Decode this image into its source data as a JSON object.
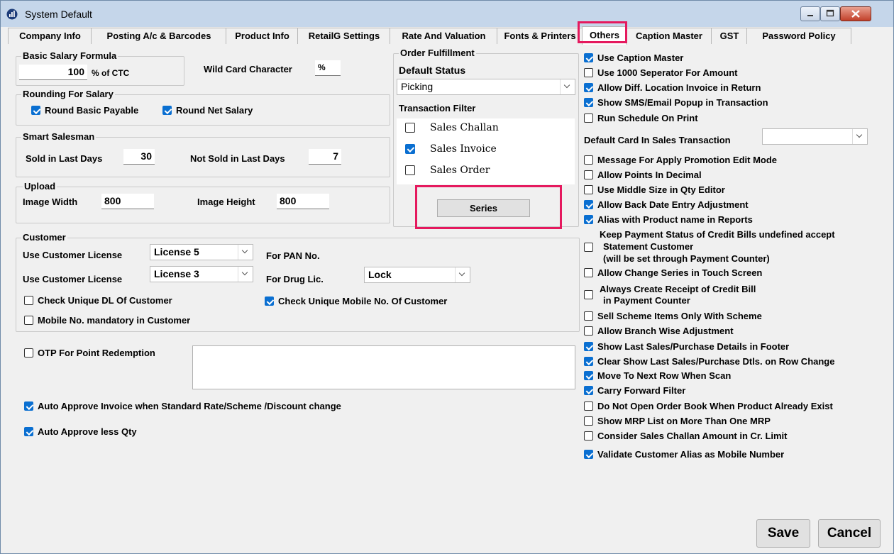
{
  "window": {
    "title": "System Default"
  },
  "tabs": [
    {
      "label": "Company Info"
    },
    {
      "label": "Posting A/c & Barcodes"
    },
    {
      "label": "Product Info"
    },
    {
      "label": "RetailG Settings"
    },
    {
      "label": "Rate And Valuation"
    },
    {
      "label": "Fonts & Printers"
    },
    {
      "label": "Others"
    },
    {
      "label": "Caption Master"
    },
    {
      "label": "GST"
    },
    {
      "label": "Password Policy"
    }
  ],
  "salary": {
    "title": "Basic Salary Formula",
    "value": "100",
    "unit": "% of CTC",
    "wildcard_label": "Wild Card Character",
    "wildcard_value": "%"
  },
  "rounding": {
    "title": "Rounding For Salary",
    "basic": "Round Basic Payable",
    "net": "Round Net Salary"
  },
  "smart": {
    "title": "Smart Salesman",
    "sold_label": "Sold in Last Days",
    "sold_value": "30",
    "notsold_label": "Not Sold in Last Days",
    "notsold_value": "7"
  },
  "upload": {
    "title": "Upload",
    "width_label": "Image Width",
    "width_value": "800",
    "height_label": "Image Height",
    "height_value": "800"
  },
  "order": {
    "title": "Order Fulfillment",
    "status_label": "Default Status",
    "status_value": "Picking",
    "filter_label": "Transaction Filter",
    "items": [
      {
        "label": "Sales Challan",
        "checked": false
      },
      {
        "label": "Sales Invoice",
        "checked": true
      },
      {
        "label": "Sales Order",
        "checked": false
      }
    ],
    "series_button": "Series"
  },
  "customer": {
    "title": "Customer",
    "license_label": "Use Customer License",
    "license1": "License 5",
    "pan_label": "For PAN No.",
    "license2": "License 3",
    "drug_label": "For Drug Lic.",
    "drug_value": "Lock",
    "unique_dl": "Check Unique DL Of Customer",
    "unique_mobile": "Check Unique Mobile No. Of Customer",
    "mobile_mandatory": "Mobile No. mandatory in Customer"
  },
  "otp_label": "OTP For Point Redemption",
  "auto_approve_invoice": "Auto Approve Invoice when Standard Rate/Scheme /Discount change",
  "auto_approve_qty": "Auto Approve less Qty",
  "right_options_a": [
    {
      "label": "Use Caption Master",
      "checked": true
    },
    {
      "label": "Use 1000 Seperator For Amount",
      "checked": false
    },
    {
      "label": "Allow Diff. Location Invoice in Return",
      "checked": true
    },
    {
      "label": "Show SMS/Email Popup in Transaction",
      "checked": true
    },
    {
      "label": "Run Schedule On Print",
      "checked": false
    }
  ],
  "default_card_label": "Default Card In Sales Transaction",
  "right_options_b": [
    {
      "label": "Message For Apply Promotion Edit Mode",
      "checked": false
    },
    {
      "label": "Allow Points In Decimal",
      "checked": false
    },
    {
      "label": "Use Middle Size in Qty Editor",
      "checked": false
    },
    {
      "label": "Allow Back Date Entry Adjustment",
      "checked": true
    },
    {
      "label": "Alias with Product name in Reports",
      "checked": true
    }
  ],
  "keep_payment": {
    "line1": "Keep Payment Status of Credit Bills undefined accept",
    "line2": "Statement Customer",
    "line3": "(will be set through Payment Counter)",
    "checked": false
  },
  "allow_change_series": {
    "label": "Allow Change Series in Touch Screen",
    "checked": false
  },
  "always_create": {
    "line1": "Always Create Receipt of Credit Bill",
    "line2": "in Payment Counter",
    "checked": false
  },
  "right_options_c": [
    {
      "label": "Sell Scheme Items Only With Scheme",
      "checked": false
    },
    {
      "label": "Allow Branch Wise Adjustment",
      "checked": false
    },
    {
      "label": "Show Last Sales/Purchase Details in Footer",
      "checked": true
    },
    {
      "label": "Clear Show Last Sales/Purchase Dtls. on Row Change",
      "checked": true
    },
    {
      "label": "Move To Next Row When Scan",
      "checked": true
    },
    {
      "label": "Carry Forward Filter",
      "checked": true
    },
    {
      "label": "Do Not Open Order Book When Product Already Exist",
      "checked": false
    },
    {
      "label": "Show MRP List on More Than One MRP",
      "checked": false
    },
    {
      "label": "Consider Sales Challan Amount in Cr. Limit",
      "checked": false
    }
  ],
  "validate_alias": {
    "label": "Validate Customer Alias as Mobile Number",
    "checked": true
  },
  "buttons": {
    "save": "Save",
    "cancel": "Cancel"
  }
}
